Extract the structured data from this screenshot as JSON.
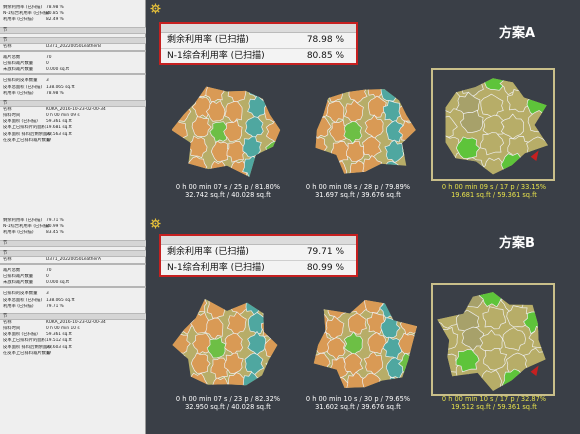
{
  "left_panel_a": {
    "top_rows": [
      {
        "k": "剩余利用率 (已扫描)",
        "v": "78.98 %"
      },
      {
        "k": "N-1综合利用率 (已扫描)",
        "v": "80.85 %"
      },
      {
        "k": "利用率 (已扫描)",
        "v": "82.49 %"
      }
    ],
    "sec1": "节",
    "sec2": "节",
    "name_rows": [
      {
        "k": "名称",
        "v": "D371_20220050LeatherB"
      }
    ],
    "count_rows": [
      {
        "k": "裁片总数",
        "v": "70"
      },
      {
        "k": "已排料裁片数量",
        "v": "0"
      },
      {
        "k": "未放料裁片数量",
        "v": "0.000 sq.ft"
      }
    ],
    "mat_rows": [
      {
        "k": "已排料的皮革数量",
        "v": "3"
      },
      {
        "k": "皮革总面积 (已扫描)",
        "v": "138.065 sq.ft"
      },
      {
        "k": "利用率 (已扫描)",
        "v": "78.98 %"
      }
    ],
    "sec3": "节",
    "detail_rows": [
      {
        "k": "名称",
        "v": "KUKA_2016-10-23-02-00-34"
      },
      {
        "k": "排料时间",
        "v": "0 h 00 min 09 s"
      },
      {
        "k": "皮革面积 (已扫描)",
        "v": "59.361 sq.ft"
      },
      {
        "k": "皮革上已排料片的面积",
        "v": "19.681 sq.ft"
      },
      {
        "k": "皮革面积 排料后剩余面积",
        "v": "32.563 sq.ft"
      },
      {
        "k": "在皮革上已排料裁片数量",
        "v": "17"
      }
    ]
  },
  "left_panel_b": {
    "top_rows": [
      {
        "k": "剩余利用率 (已扫描)",
        "v": "79.71 %"
      },
      {
        "k": "N-1综合利用率 (已扫描)",
        "v": "80.99 %"
      },
      {
        "k": "利用率 (已扫描)",
        "v": "83.45 %"
      }
    ],
    "sec1": "节",
    "sec2": "节",
    "name_rows": [
      {
        "k": "名称",
        "v": "D371_20220050LeatherA"
      }
    ],
    "count_rows": [
      {
        "k": "裁片总数",
        "v": "70"
      },
      {
        "k": "已排料裁片数量",
        "v": "0"
      },
      {
        "k": "未放料裁片数量",
        "v": "0.000 sq.ft"
      }
    ],
    "mat_rows": [
      {
        "k": "已排料的皮革数量",
        "v": "3"
      },
      {
        "k": "皮革总面积 (已扫描)",
        "v": "138.065 sq.ft"
      },
      {
        "k": "利用率 (已扫描)",
        "v": "79.71 %"
      }
    ],
    "sec3": "节",
    "detail_rows": [
      {
        "k": "名称",
        "v": "KUKA_2016-10-23-02-00-34"
      },
      {
        "k": "排料时间",
        "v": "0 h 00 min 10 s"
      },
      {
        "k": "皮革面积 (已扫描)",
        "v": "59.361 sq.ft"
      },
      {
        "k": "皮革上已排料片的面积",
        "v": "19.512 sq.ft"
      },
      {
        "k": "皮革面积 排料后剩余面积",
        "v": "33.603 sq.ft"
      },
      {
        "k": "在皮革上已排料裁片数量",
        "v": "17"
      }
    ]
  },
  "plan_a": {
    "title": "方案A",
    "stat1_label": "剩余利用率 (已扫描)",
    "stat1_value": "78.98 %",
    "stat2_label": "N-1综合利用率 (已扫描)",
    "stat2_value": "80.85 %",
    "hides": [
      {
        "line1": "0 h 00 min 07 s /  25 p / 81.80%",
        "line2": "32.742 sq.ft / 40.028 sq.ft"
      },
      {
        "line1": "0 h 00 min 08 s /  28 p / 79.89%",
        "line2": "31.697 sq.ft / 39.676 sq.ft"
      },
      {
        "line1": "0 h 00 min 09 s /  17 p / 33.15%",
        "line2": "19.681 sq.ft / 59.361 sq.ft"
      }
    ]
  },
  "plan_b": {
    "title": "方案B",
    "stat1_label": "剩余利用率 (已扫描)",
    "stat1_value": "79.71 %",
    "stat2_label": "N-1综合利用率 (已扫描)",
    "stat2_value": "80.99 %",
    "hides": [
      {
        "line1": "0 h 00 min 07 s /  23 p / 82.32%",
        "line2": "32.950 sq.ft / 40.028 sq.ft"
      },
      {
        "line1": "0 h 00 min 10 s /  30 p / 79.65%",
        "line2": "31.602 sq.ft / 39.676 sq.ft"
      },
      {
        "line1": "0 h 00 min 10 s /  17 p / 32.87%",
        "line2": "19.512 sq.ft / 59.361 sq.ft"
      }
    ]
  },
  "colors": {
    "leather": "#b7ad68",
    "piece": "#d99a55",
    "highlight": "#e8e24c",
    "alert": "#c62020"
  },
  "icons": {
    "gear": "gear-icon"
  }
}
